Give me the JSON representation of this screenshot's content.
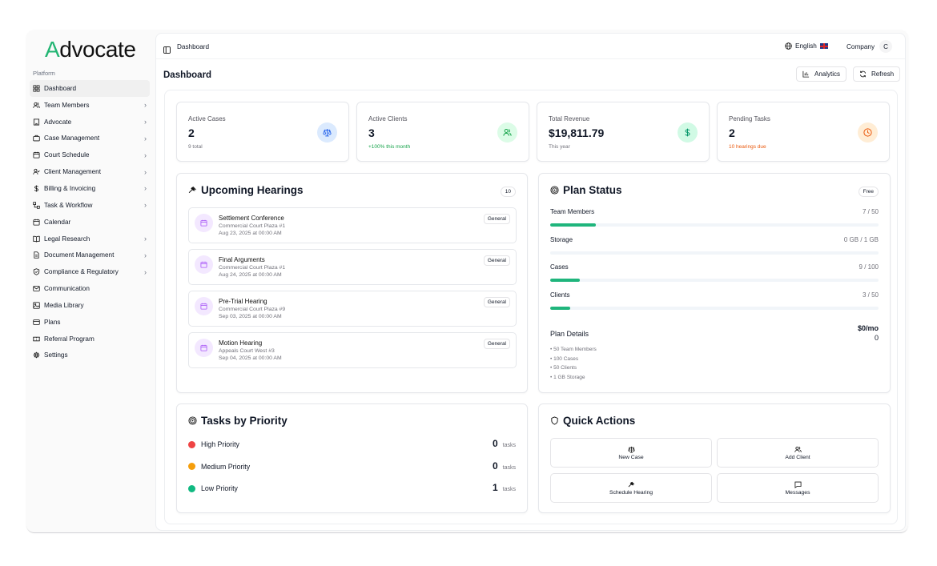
{
  "sidebar": {
    "logo_first": "A",
    "logo_rest": "dvocate",
    "section": "Platform",
    "items": [
      {
        "label": "Dashboard",
        "icon": "grid-icon",
        "chevron": false,
        "active": true
      },
      {
        "label": "Team Members",
        "icon": "users-icon",
        "chevron": true
      },
      {
        "label": "Advocate",
        "icon": "building-icon",
        "chevron": true
      },
      {
        "label": "Case Management",
        "icon": "briefcase-icon",
        "chevron": true
      },
      {
        "label": "Court Schedule",
        "icon": "calendar-icon",
        "chevron": true
      },
      {
        "label": "Client Management",
        "icon": "user-check-icon",
        "chevron": true
      },
      {
        "label": "Billing & Invoicing",
        "icon": "dollar-icon",
        "chevron": true
      },
      {
        "label": "Task & Workflow",
        "icon": "workflow-icon",
        "chevron": true
      },
      {
        "label": "Calendar",
        "icon": "calendar-icon",
        "chevron": false
      },
      {
        "label": "Legal Research",
        "icon": "book-icon",
        "chevron": true
      },
      {
        "label": "Document Management",
        "icon": "file-icon",
        "chevron": true
      },
      {
        "label": "Compliance & Regulatory",
        "icon": "shield-icon",
        "chevron": true
      },
      {
        "label": "Communication",
        "icon": "mail-icon",
        "chevron": false
      },
      {
        "label": "Media Library",
        "icon": "image-icon",
        "chevron": false
      },
      {
        "label": "Plans",
        "icon": "card-icon",
        "chevron": false
      },
      {
        "label": "Referral Program",
        "icon": "ticket-icon",
        "chevron": false
      },
      {
        "label": "Settings",
        "icon": "gear-icon",
        "chevron": false
      }
    ]
  },
  "topbar": {
    "breadcrumb": "Dashboard",
    "language": "English",
    "company": "Company",
    "avatar": "C"
  },
  "header": {
    "title": "Dashboard",
    "analytics": "Analytics",
    "refresh": "Refresh"
  },
  "stats": [
    {
      "label": "Active Cases",
      "value": "2",
      "sub": "9 total",
      "sub_color": "#71717a",
      "icon": "scale-icon",
      "bg": "#dbeafe",
      "fg": "#2563eb"
    },
    {
      "label": "Active Clients",
      "value": "3",
      "sub": "+100% this month",
      "sub_color": "#16a34a",
      "icon": "users-icon",
      "bg": "#dcfce7",
      "fg": "#16a34a"
    },
    {
      "label": "Total Revenue",
      "value": "$19,811.79",
      "sub": "This year",
      "sub_color": "#71717a",
      "icon": "dollar-icon",
      "bg": "#d1fae5",
      "fg": "#059669"
    },
    {
      "label": "Pending Tasks",
      "value": "2",
      "sub": "10 hearings due",
      "sub_color": "#ea580c",
      "icon": "clock-icon",
      "bg": "#ffedd5",
      "fg": "#ea580c"
    }
  ],
  "hearings": {
    "title": "Upcoming Hearings",
    "count": "10",
    "items": [
      {
        "title": "Settlement Conference",
        "location": "Commercial Court Plaza #1",
        "date": "Aug 23, 2025 at 00:00 AM",
        "tag": "General"
      },
      {
        "title": "Final Arguments",
        "location": "Commercial Court Plaza #1",
        "date": "Aug 24, 2025 at 00:00 AM",
        "tag": "General"
      },
      {
        "title": "Pre-Trial Hearing",
        "location": "Commercial Court Plaza #9",
        "date": "Sep 03, 2025 at 00:00 AM",
        "tag": "General"
      },
      {
        "title": "Motion Hearing",
        "location": "Appeals Court West #3",
        "date": "Sep 04, 2025 at 00:00 AM",
        "tag": "General"
      }
    ]
  },
  "plan": {
    "title": "Plan Status",
    "badge": "Free",
    "rows": [
      {
        "label": "Team Members",
        "value": "7 / 50",
        "fraction": 0.14
      },
      {
        "label": "Storage",
        "value": "0 GB / 1 GB",
        "fraction": 0
      },
      {
        "label": "Cases",
        "value": "9 / 100",
        "fraction": 0.09
      },
      {
        "label": "Clients",
        "value": "3 / 50",
        "fraction": 0.06
      }
    ],
    "details_title": "Plan Details",
    "price": "$0/mo",
    "price_extra": "0",
    "details": [
      "• 50 Team Members",
      "• 100 Cases",
      "• 50 Clients",
      "• 1 GB Storage"
    ]
  },
  "tasks": {
    "title": "Tasks by Priority",
    "unit": "tasks",
    "items": [
      {
        "label": "High Priority",
        "count": "0",
        "color": "#ef4444"
      },
      {
        "label": "Medium Priority",
        "count": "0",
        "color": "#f59e0b"
      },
      {
        "label": "Low Priority",
        "count": "1",
        "color": "#10b981"
      }
    ]
  },
  "quick": {
    "title": "Quick Actions",
    "actions": [
      {
        "label": "New Case",
        "icon": "scale-icon"
      },
      {
        "label": "Add Client",
        "icon": "users-icon"
      },
      {
        "label": "Schedule Hearing",
        "icon": "gavel-icon"
      },
      {
        "label": "Messages",
        "icon": "message-icon"
      }
    ]
  }
}
